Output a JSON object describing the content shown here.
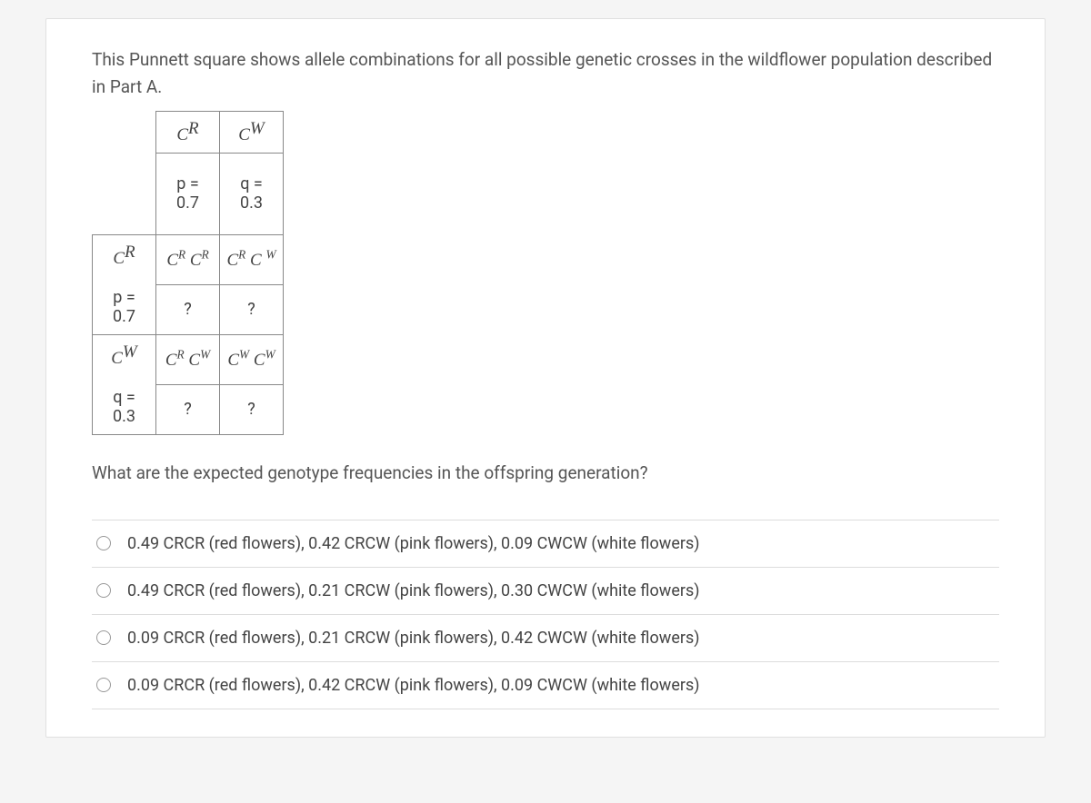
{
  "intro": "This Punnett square shows allele combinations for all possible genetic crosses in the wildflower population described in Part A.",
  "punnett": {
    "col_headers": {
      "c1_allele": "C",
      "c1_sup": "R",
      "c2_allele": "C",
      "c2_sup": "W",
      "c1_freq_label": "p =",
      "c1_freq_val": "0.7",
      "c2_freq_label": "q =",
      "c2_freq_val": "0.3"
    },
    "row_headers": {
      "r1_allele": "C",
      "r1_sup": "R",
      "r1_freq_label": "p =",
      "r1_freq_val": "0.7",
      "r2_allele": "C",
      "r2_sup": "W",
      "r2_freq_label": "q =",
      "r2_freq_val": "0.3"
    },
    "cells": {
      "r1c1_geno": "CR CR",
      "r1c2_geno": "CR C W",
      "r2c1_geno": "CR CW",
      "r2c2_geno": "CW CW",
      "unknown": "?"
    }
  },
  "question": "What are the expected genotype frequencies in the offspring generation?",
  "options": [
    "0.49 CRCR (red flowers), 0.42 CRCW (pink flowers), 0.09 CWCW (white flowers)",
    "0.49 CRCR (red flowers), 0.21 CRCW (pink flowers), 0.30 CWCW (white flowers)",
    "0.09 CRCR (red flowers), 0.21 CRCW (pink flowers), 0.42 CWCW (white flowers)",
    "0.09 CRCR (red flowers), 0.42 CRCW (pink flowers), 0.09 CWCW (white flowers)"
  ]
}
